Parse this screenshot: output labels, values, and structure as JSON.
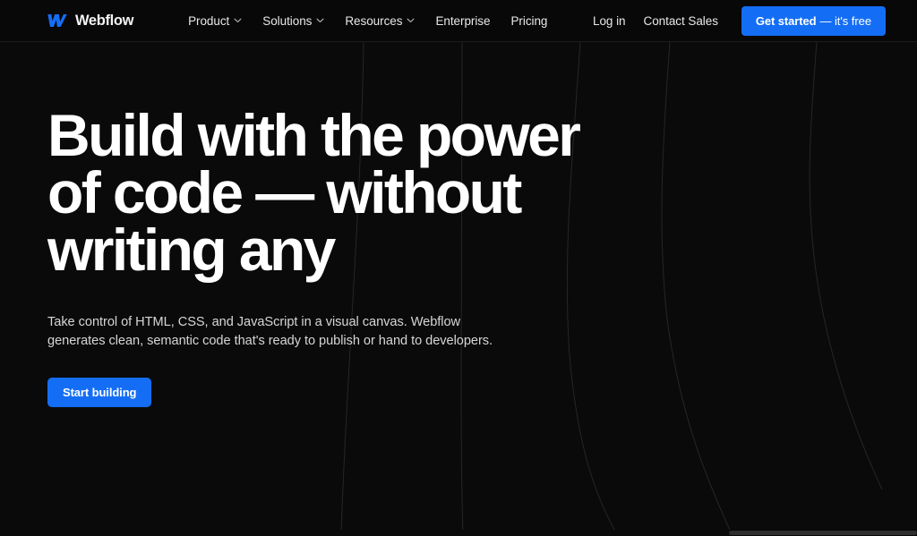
{
  "brand": {
    "name": "Webflow",
    "logo_icon": "webflow-logo-icon",
    "accent_color": "#146EF5",
    "background_color": "#0A0A0A",
    "navbar_color": "#080808",
    "text_color": "#FFFFFF"
  },
  "navbar": {
    "links": [
      {
        "label": "Product",
        "has_dropdown": true,
        "icon": "chevron-down-icon"
      },
      {
        "label": "Solutions",
        "has_dropdown": true,
        "icon": "chevron-down-icon"
      },
      {
        "label": "Resources",
        "has_dropdown": true,
        "icon": "chevron-down-icon"
      },
      {
        "label": "Enterprise",
        "has_dropdown": false,
        "icon": ""
      },
      {
        "label": "Pricing",
        "has_dropdown": false,
        "icon": ""
      }
    ],
    "login_label": "Log in",
    "contact_label": "Contact Sales",
    "cta_bold": "Get started",
    "cta_thin": "— it's free"
  },
  "hero": {
    "headline_lines": [
      "Build with the power",
      "of code — without",
      "writing any"
    ],
    "subtext_lines": [
      "Take control of HTML, CSS, and JavaScript in a visual canvas. Webflow",
      "generates clean, semantic code that's ready to publish or hand to developers."
    ],
    "cta_label": "Start building"
  }
}
